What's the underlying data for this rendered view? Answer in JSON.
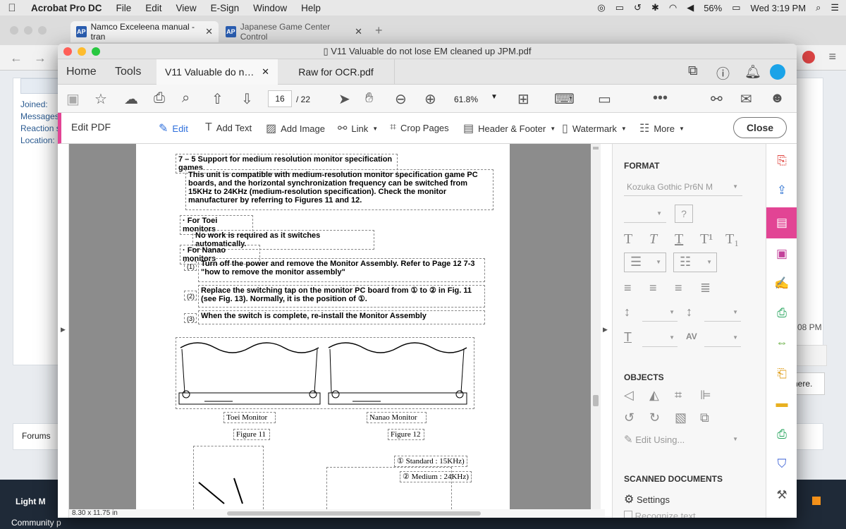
{
  "menubar": {
    "app": "Acrobat Pro DC",
    "items": [
      "File",
      "Edit",
      "View",
      "E-Sign",
      "Window",
      "Help"
    ],
    "battery": "56%",
    "clock": "Wed 3:19 PM"
  },
  "browser": {
    "tabs": [
      {
        "label": "Namco Exceleena manual - tran"
      },
      {
        "label": "Japanese Game Center Control"
      }
    ],
    "forum": {
      "labels": [
        "Joined:",
        "Messages",
        "Reaction s",
        "Location:"
      ],
      "footer": "Forums",
      "side_text_1": "08 PM",
      "side_text_2": "here.",
      "band_1": "Light M",
      "band_2": "Community p"
    }
  },
  "window": {
    "title": "V11 Valuable do not lose EM cleaned up JPM.pdf",
    "nav": {
      "home": "Home",
      "tools": "Tools"
    },
    "doc_tabs": [
      {
        "label": "V11 Valuable do n…"
      },
      {
        "label": "Raw for OCR.pdf"
      }
    ]
  },
  "toolbar": {
    "page_current": "16",
    "page_total": "/ 22",
    "zoom": "61.8%"
  },
  "editbar": {
    "title": "Edit PDF",
    "tools": {
      "edit": "Edit",
      "add_text": "Add Text",
      "add_image": "Add Image",
      "link": "Link",
      "crop": "Crop Pages",
      "header_footer": "Header & Footer",
      "watermark": "Watermark",
      "more": "More"
    },
    "close": "Close"
  },
  "document": {
    "heading": "7 – 5   Support for medium resolution monitor specification games",
    "intro": "This unit is compatible with medium-resolution monitor specification game PC boards, and the horizontal synchronization frequency can be switched from 15KHz to 24KHz (medium-resolution specification). Check the monitor manufacturer by referring to Figures 11 and 12.",
    "toei_head": "· For Toei monitors",
    "toei_text": "No work is required as it switches automatically.",
    "nanao_head": "· For Nanao monitors",
    "steps": [
      {
        "num": "(1)",
        "text": "Turn off the power and remove the Monitor Assembly. Refer to Page 12 7-3 \"how to remove the monitor assembly\""
      },
      {
        "num": "(2)",
        "text": "Replace the switching tap on the monitor PC board from ① to ② in Fig. 11 (see Fig. 13). Normally, it is the position of ①."
      },
      {
        "num": "(3)",
        "text": "When the switch is complete, re-install the Monitor Assembly"
      }
    ],
    "fig11_caption": "Toei Monitor",
    "fig11_label": "Figure 11",
    "fig12_caption": "Nanao Monitor",
    "fig12_label": "Figure 12",
    "standard_label": "① Standard : 15KHz)",
    "medium_label": "② Medium : 24KHz)",
    "page_size": "8.30 x 11.75 in"
  },
  "panel": {
    "format_title": "FORMAT",
    "font": "Kozuka Gothic Pr6N M",
    "objects_title": "OBJECTS",
    "edit_using": "Edit Using...",
    "scanned_title": "SCANNED DOCUMENTS",
    "settings": "Settings",
    "recognize": "Recognize text"
  }
}
